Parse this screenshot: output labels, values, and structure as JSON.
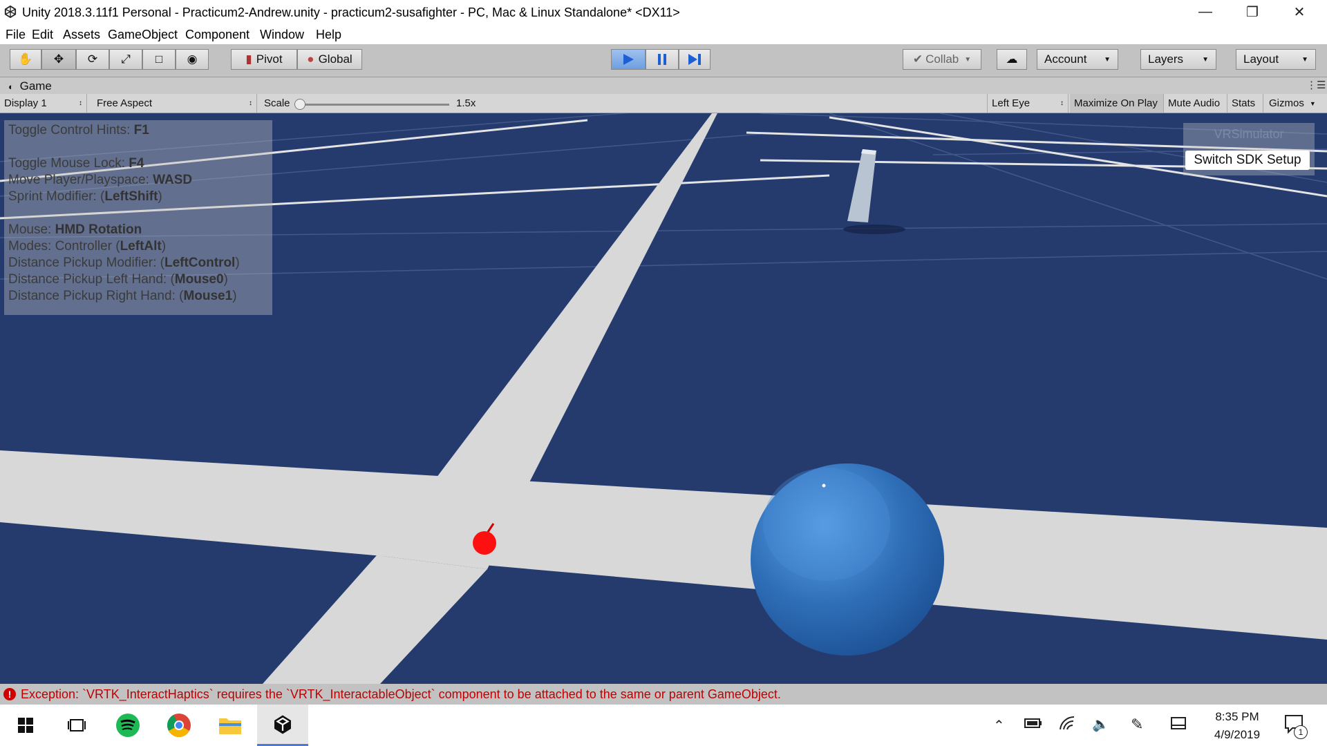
{
  "window": {
    "title": "Unity 2018.3.11f1 Personal - Practicum2-Andrew.unity - practicum2-susafighter - PC, Mac & Linux Standalone* <DX11>"
  },
  "menu": [
    "File",
    "Edit",
    "Assets",
    "GameObject",
    "Component",
    "Window",
    "Help"
  ],
  "toolbar": {
    "pivot_label": "Pivot",
    "global_label": "Global",
    "collab_label": "Collab",
    "account_label": "Account",
    "layers_label": "Layers",
    "layout_label": "Layout"
  },
  "game_tab": {
    "label": "Game",
    "display": "Display 1",
    "aspect": "Free Aspect",
    "scale_label": "Scale",
    "scale_value": "1.5x",
    "eye": "Left Eye",
    "maximize": "Maximize On Play",
    "mute": "Mute Audio",
    "stats": "Stats",
    "gizmos": "Gizmos"
  },
  "hints": [
    {
      "text": "Toggle Control Hints: ",
      "key": "F1"
    },
    {
      "text": "Toggle Mouse Lock: ",
      "key": "F4"
    },
    {
      "text": "Move Player/Playspace: ",
      "key": "WASD"
    },
    {
      "text": "Sprint Modifier: (",
      "key": "LeftShift",
      "suffix": ")"
    },
    {
      "text": "Mouse: ",
      "key": "HMD Rotation"
    },
    {
      "text": "Modes: Controller (",
      "key": "LeftAlt",
      "suffix": ")"
    },
    {
      "text": "Distance Pickup Modifier: (",
      "key": "LeftControl",
      "suffix": ")"
    },
    {
      "text": "Distance Pickup Left Hand: (",
      "key": "Mouse0",
      "suffix": ")"
    },
    {
      "text": "Distance Pickup Right Hand: (",
      "key": "Mouse1",
      "suffix": ")"
    }
  ],
  "vrsim": {
    "title": "VRSimulator",
    "button": "Switch SDK Setup"
  },
  "status": {
    "message": "Exception: `VRTK_InteractHaptics` requires the `VRTK_InteractableObject` component to be attached to the same or parent GameObject."
  },
  "taskbar": {
    "time": "8:35 PM",
    "date": "4/9/2019",
    "notifications": "1"
  },
  "colors": {
    "floor": "#253b6e",
    "road": "#d8d8d8",
    "sphere": "#2f6fb8",
    "error": "#c00000",
    "play_accent": "#6d9fe0"
  }
}
